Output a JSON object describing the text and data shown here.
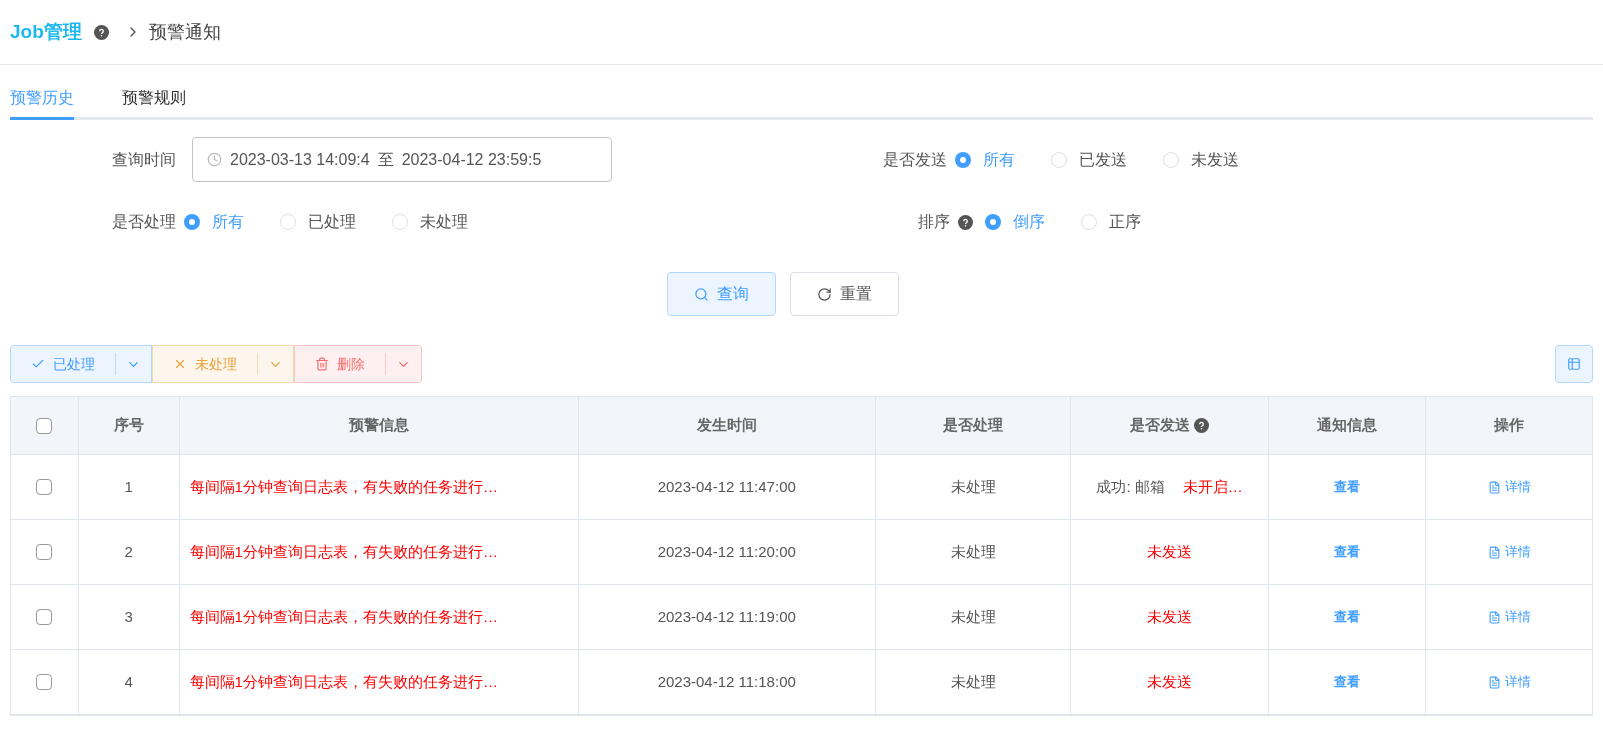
{
  "breadcrumb": {
    "root": "Job管理",
    "current": "预警通知"
  },
  "tabs": [
    {
      "label": "预警历史",
      "selected": true
    },
    {
      "label": "预警规则",
      "selected": false
    }
  ],
  "filters": {
    "time_label": "查询时间",
    "time_start": "2023-03-13 14:09:4",
    "time_separator": "至",
    "time_end": "2023-04-12 23:59:5",
    "radio_groups": [
      {
        "label": "是否发送",
        "help": false,
        "options": [
          {
            "label": "所有",
            "selected": true
          },
          {
            "label": "已发送",
            "selected": false
          },
          {
            "label": "未发送",
            "selected": false
          }
        ]
      },
      {
        "label": "是否处理",
        "help": false,
        "options": [
          {
            "label": "所有",
            "selected": true
          },
          {
            "label": "已处理",
            "selected": false
          },
          {
            "label": "未处理",
            "selected": false
          }
        ]
      },
      {
        "label": "排序",
        "help": true,
        "options": [
          {
            "label": "倒序",
            "selected": true
          },
          {
            "label": "正序",
            "selected": false
          }
        ]
      }
    ],
    "buttons": [
      {
        "label": "查询",
        "kind": "search"
      },
      {
        "label": "重置",
        "kind": "reset"
      }
    ]
  },
  "toolbar": [
    {
      "label": "已处理",
      "kind": "done"
    },
    {
      "label": "未处理",
      "kind": "undone"
    },
    {
      "label": "删除",
      "kind": "delete"
    }
  ],
  "table": {
    "select_all_checked": false,
    "columns": [
      {
        "label": "序号",
        "help": false
      },
      {
        "label": "预警信息",
        "help": false
      },
      {
        "label": "发生时间",
        "help": false
      },
      {
        "label": "是否处理",
        "help": false
      },
      {
        "label": "是否发送",
        "help": true
      },
      {
        "label": "通知信息",
        "help": false
      },
      {
        "label": "操作",
        "help": false
      }
    ],
    "rows": [
      {
        "checked": false,
        "index": "1",
        "message": "每间隔1分钟查询日志表，有失败的任务进行…",
        "time": "2023-04-12 11:47:00",
        "handled": "未处理",
        "sent": [
          {
            "text": "成功: 邮箱",
            "kind": "success"
          },
          {
            "text": "未开启…",
            "kind": "failure"
          }
        ],
        "notice": "查看",
        "action": "详情"
      },
      {
        "checked": false,
        "index": "2",
        "message": "每间隔1分钟查询日志表，有失败的任务进行…",
        "time": "2023-04-12 11:20:00",
        "handled": "未处理",
        "sent": [
          {
            "text": "未发送",
            "kind": "failure"
          }
        ],
        "notice": "查看",
        "action": "详情"
      },
      {
        "checked": false,
        "index": "3",
        "message": "每间隔1分钟查询日志表，有失败的任务进行…",
        "time": "2023-04-12 11:19:00",
        "handled": "未处理",
        "sent": [
          {
            "text": "未发送",
            "kind": "failure"
          }
        ],
        "notice": "查看",
        "action": "详情"
      },
      {
        "checked": false,
        "index": "4",
        "message": "每间隔1分钟查询日志表，有失败的任务进行…",
        "time": "2023-04-12 11:18:00",
        "handled": "未处理",
        "sent": [
          {
            "text": "未发送",
            "kind": "failure"
          }
        ],
        "notice": "查看",
        "action": "详情"
      }
    ]
  }
}
